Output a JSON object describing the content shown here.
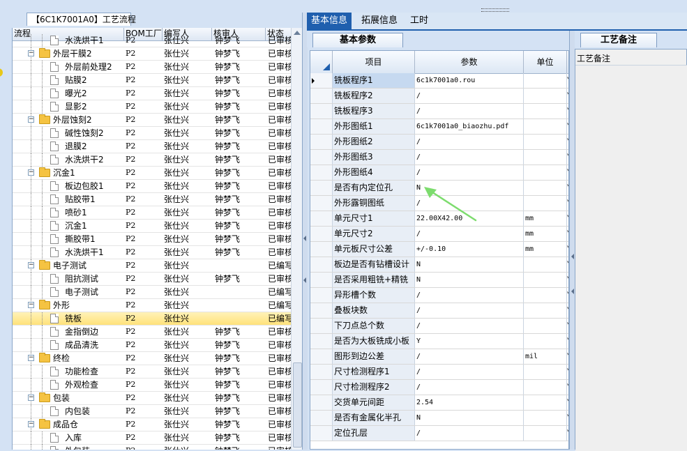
{
  "left_panel": {
    "tab_title": "【6C1K7001A0】工艺流程",
    "headers": [
      "流程",
      "BOM工厂",
      "编写人",
      "核审人",
      "状态"
    ]
  },
  "tree_rows": [
    {
      "level": 1,
      "type": "doc",
      "name": "水洗烘干1",
      "bom": "P2",
      "writer": "张仕兴",
      "reviewer": "钟梦飞",
      "status": "已审核",
      "partial": true
    },
    {
      "level": 0,
      "type": "folder",
      "name": "外层干膜2",
      "bom": "P2",
      "writer": "张仕兴",
      "reviewer": "钟梦飞",
      "status": "已审核"
    },
    {
      "level": 1,
      "type": "doc",
      "name": "外层前处理2",
      "bom": "P2",
      "writer": "张仕兴",
      "reviewer": "钟梦飞",
      "status": "已审核"
    },
    {
      "level": 1,
      "type": "doc",
      "name": "贴膜2",
      "bom": "P2",
      "writer": "张仕兴",
      "reviewer": "钟梦飞",
      "status": "已审核"
    },
    {
      "level": 1,
      "type": "doc",
      "name": "曝光2",
      "bom": "P2",
      "writer": "张仕兴",
      "reviewer": "钟梦飞",
      "status": "已审核"
    },
    {
      "level": 1,
      "type": "doc",
      "name": "显影2",
      "bom": "P2",
      "writer": "张仕兴",
      "reviewer": "钟梦飞",
      "status": "已审核"
    },
    {
      "level": 0,
      "type": "folder",
      "name": "外层蚀刻2",
      "bom": "P2",
      "writer": "张仕兴",
      "reviewer": "钟梦飞",
      "status": "已审核"
    },
    {
      "level": 1,
      "type": "doc",
      "name": "碱性蚀刻2",
      "bom": "P2",
      "writer": "张仕兴",
      "reviewer": "钟梦飞",
      "status": "已审核"
    },
    {
      "level": 1,
      "type": "doc",
      "name": "退膜2",
      "bom": "P2",
      "writer": "张仕兴",
      "reviewer": "钟梦飞",
      "status": "已审核"
    },
    {
      "level": 1,
      "type": "doc",
      "name": "水洗烘干2",
      "bom": "P2",
      "writer": "张仕兴",
      "reviewer": "钟梦飞",
      "status": "已审核"
    },
    {
      "level": 0,
      "type": "folder",
      "name": "沉金1",
      "bom": "P2",
      "writer": "张仕兴",
      "reviewer": "钟梦飞",
      "status": "已审核"
    },
    {
      "level": 1,
      "type": "doc",
      "name": "板边包胶1",
      "bom": "P2",
      "writer": "张仕兴",
      "reviewer": "钟梦飞",
      "status": "已审核"
    },
    {
      "level": 1,
      "type": "doc",
      "name": "贴胶带1",
      "bom": "P2",
      "writer": "张仕兴",
      "reviewer": "钟梦飞",
      "status": "已审核"
    },
    {
      "level": 1,
      "type": "doc",
      "name": "喷砂1",
      "bom": "P2",
      "writer": "张仕兴",
      "reviewer": "钟梦飞",
      "status": "已审核"
    },
    {
      "level": 1,
      "type": "doc",
      "name": "沉金1",
      "bom": "P2",
      "writer": "张仕兴",
      "reviewer": "钟梦飞",
      "status": "已审核"
    },
    {
      "level": 1,
      "type": "doc",
      "name": "撕胶带1",
      "bom": "P2",
      "writer": "张仕兴",
      "reviewer": "钟梦飞",
      "status": "已审核"
    },
    {
      "level": 1,
      "type": "doc",
      "name": "水洗烘干1",
      "bom": "P2",
      "writer": "张仕兴",
      "reviewer": "钟梦飞",
      "status": "已审核"
    },
    {
      "level": 0,
      "type": "folder",
      "name": "电子测试",
      "bom": "P2",
      "writer": "张仕兴",
      "reviewer": "",
      "status": "已编写"
    },
    {
      "level": 1,
      "type": "doc",
      "name": "阻抗测试",
      "bom": "P2",
      "writer": "张仕兴",
      "reviewer": "钟梦飞",
      "status": "已审核"
    },
    {
      "level": 1,
      "type": "doc",
      "name": "电子测试",
      "bom": "P2",
      "writer": "张仕兴",
      "reviewer": "",
      "status": "已编写"
    },
    {
      "level": 0,
      "type": "folder",
      "name": "外形",
      "bom": "P2",
      "writer": "张仕兴",
      "reviewer": "",
      "status": "已编写"
    },
    {
      "level": 1,
      "type": "doc",
      "name": "铣板",
      "bom": "P2",
      "writer": "张仕兴",
      "reviewer": "",
      "status": "已编写",
      "selected": true
    },
    {
      "level": 1,
      "type": "doc",
      "name": "金指倒边",
      "bom": "P2",
      "writer": "张仕兴",
      "reviewer": "钟梦飞",
      "status": "已审核"
    },
    {
      "level": 1,
      "type": "doc",
      "name": "成品清洗",
      "bom": "P2",
      "writer": "张仕兴",
      "reviewer": "钟梦飞",
      "status": "已审核"
    },
    {
      "level": 0,
      "type": "folder",
      "name": "终检",
      "bom": "P2",
      "writer": "张仕兴",
      "reviewer": "钟梦飞",
      "status": "已审核"
    },
    {
      "level": 1,
      "type": "doc",
      "name": "功能检查",
      "bom": "P2",
      "writer": "张仕兴",
      "reviewer": "钟梦飞",
      "status": "已审核"
    },
    {
      "level": 1,
      "type": "doc",
      "name": "外观检查",
      "bom": "P2",
      "writer": "张仕兴",
      "reviewer": "钟梦飞",
      "status": "已审核"
    },
    {
      "level": 0,
      "type": "folder",
      "name": "包装",
      "bom": "P2",
      "writer": "张仕兴",
      "reviewer": "钟梦飞",
      "status": "已审核"
    },
    {
      "level": 1,
      "type": "doc",
      "name": "内包装",
      "bom": "P2",
      "writer": "张仕兴",
      "reviewer": "钟梦飞",
      "status": "已审核"
    },
    {
      "level": 0,
      "type": "folder",
      "name": "成品仓",
      "bom": "P2",
      "writer": "张仕兴",
      "reviewer": "钟梦飞",
      "status": "已审核"
    },
    {
      "level": 1,
      "type": "doc",
      "name": "入库",
      "bom": "P2",
      "writer": "张仕兴",
      "reviewer": "钟梦飞",
      "status": "已审核"
    },
    {
      "level": 1,
      "type": "doc",
      "name": "外包装",
      "bom": "P2",
      "writer": "张仕兴",
      "reviewer": "钟梦飞",
      "status": "已审核",
      "partial": true
    }
  ],
  "top_tabs": [
    "基本信息",
    "拓展信息",
    "工时"
  ],
  "sub_tab": "基本参数",
  "grid": {
    "headers": [
      "项目",
      "参数",
      "单位"
    ],
    "rows": [
      {
        "name": "铣板程序1",
        "value": "6c1k7001a0.rou",
        "unit": "",
        "extra": "Y"
      },
      {
        "name": "铣板程序2",
        "value": "/",
        "unit": "",
        "extra": "Y"
      },
      {
        "name": "铣板程序3",
        "value": "/",
        "unit": "",
        "extra": "Y"
      },
      {
        "name": "外形图纸1",
        "value": "6c1k7001a0_biaozhu.pdf",
        "unit": "",
        "extra": "Y"
      },
      {
        "name": "外形图纸2",
        "value": "/",
        "unit": "",
        "extra": "Y"
      },
      {
        "name": "外形图纸3",
        "value": "/",
        "unit": "",
        "extra": "Y"
      },
      {
        "name": "外形图纸4",
        "value": "/",
        "unit": "",
        "extra": "Y"
      },
      {
        "name": "是否有内定位孔",
        "value": "N",
        "unit": "",
        "extra": "Y"
      },
      {
        "name": "外形露铜图纸",
        "value": "/",
        "unit": "",
        "extra": "Y"
      },
      {
        "name": "单元尺寸1",
        "value": "22.00X42.00",
        "unit": "mm",
        "extra": "Y"
      },
      {
        "name": "单元尺寸2",
        "value": "/",
        "unit": "mm",
        "extra": "Y"
      },
      {
        "name": "单元板尺寸公差",
        "value": "+/-0.10",
        "unit": "mm",
        "extra": "Y"
      },
      {
        "name": "板边是否有钻槽设计",
        "value": "N",
        "unit": "",
        "extra": "Y"
      },
      {
        "name": "是否采用粗铣+精铣",
        "value": "N",
        "unit": "",
        "extra": "Y"
      },
      {
        "name": "异形槽个数",
        "value": "/",
        "unit": "",
        "extra": "Y"
      },
      {
        "name": "叠板块数",
        "value": "/",
        "unit": "",
        "extra": "Y"
      },
      {
        "name": "下刀点总个数",
        "value": "/",
        "unit": "",
        "extra": "Y"
      },
      {
        "name": "是否为大板铣成小板",
        "value": "Y",
        "unit": "",
        "extra": "Y"
      },
      {
        "name": "图形到边公差",
        "value": "/",
        "unit": "mil",
        "extra": "Y"
      },
      {
        "name": "尺寸检测程序1",
        "value": "/",
        "unit": "",
        "extra": "Y"
      },
      {
        "name": "尺寸检测程序2",
        "value": "/",
        "unit": "",
        "extra": "Y"
      },
      {
        "name": "交货单元间距",
        "value": "2.54",
        "unit": "",
        "extra": "Y"
      },
      {
        "name": "是否有金属化半孔",
        "value": "N",
        "unit": "",
        "extra": "Y"
      },
      {
        "name": "定位孔层",
        "value": "/",
        "unit": "",
        "extra": "Y"
      }
    ]
  },
  "notes": {
    "tab": "工艺备注",
    "label": "工艺备注"
  },
  "colors": {
    "accent": "#1f5fae",
    "selection": "#ffe27a",
    "annotation_arrow": "#7ddc6e"
  }
}
